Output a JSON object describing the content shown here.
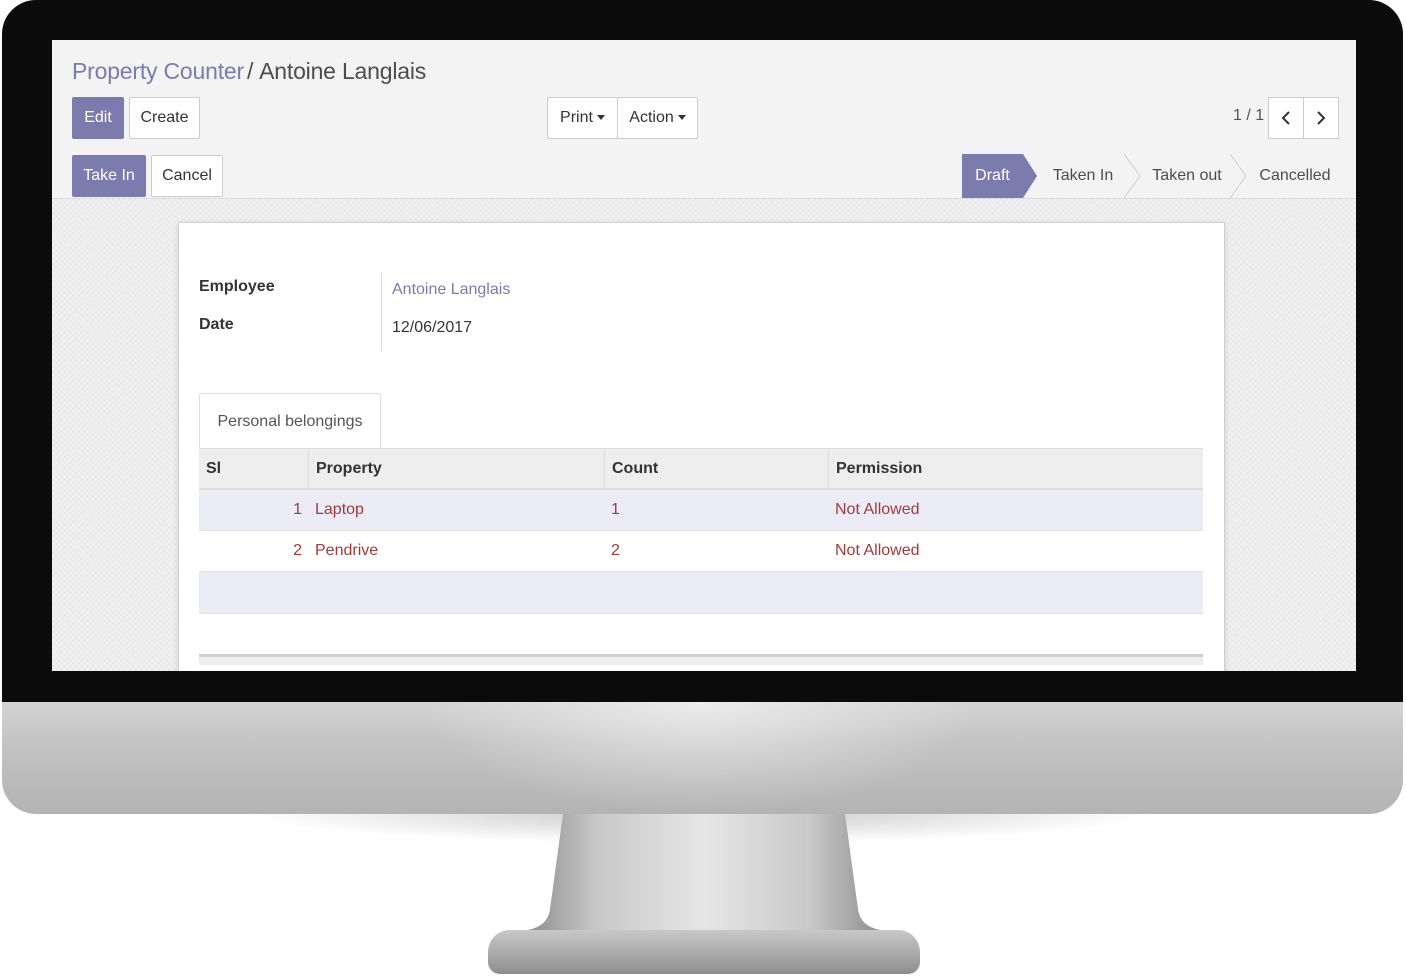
{
  "breadcrumb": {
    "parent": "Property Counter",
    "separator": "/",
    "current": "Antoine Langlais"
  },
  "toolbar": {
    "edit": "Edit",
    "create": "Create",
    "print": "Print",
    "action": "Action",
    "pager": "1 / 1"
  },
  "statusbar": {
    "take_in": "Take In",
    "cancel": "Cancel",
    "stages": [
      "Draft",
      "Taken In",
      "Taken out",
      "Cancelled"
    ],
    "active_stage": "Draft"
  },
  "form": {
    "employee_label": "Employee",
    "employee_value": "Antoine Langlais",
    "date_label": "Date",
    "date_value": "12/06/2017"
  },
  "tab": {
    "label": "Personal belongings"
  },
  "grid": {
    "headers": [
      "Sl",
      "Property",
      "Count",
      "Permission"
    ],
    "rows": [
      {
        "sl": "1",
        "property": "Laptop",
        "count": "1",
        "permission": "Not Allowed"
      },
      {
        "sl": "2",
        "property": "Pendrive",
        "count": "2",
        "permission": "Not Allowed"
      }
    ]
  },
  "colors": {
    "brand": "#7c7bad",
    "row_text": "#a23a3a",
    "row_highlight": "#ececf6"
  },
  "icons": {
    "prev": "chevron-left-icon",
    "next": "chevron-right-icon",
    "dropdown": "caret-down-icon"
  }
}
